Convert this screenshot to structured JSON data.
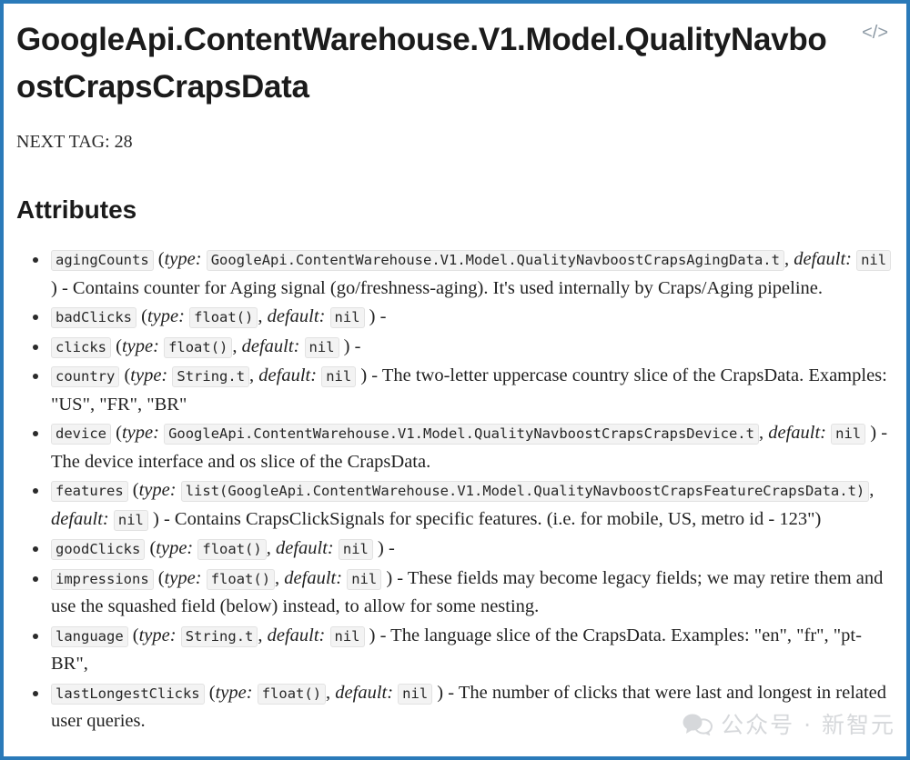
{
  "document": {
    "title": "GoogleApi.ContentWarehouse.V1.Model.QualityNavboostCrapsCrapsData",
    "code_icon": "</>",
    "next_tag": "NEXT TAG: 28",
    "section_heading": "Attributes"
  },
  "labels": {
    "type_label": "type:",
    "default_label": "default:",
    "open_paren": "(",
    "close_paren": ")",
    "comma": ",",
    "dash": "-"
  },
  "attributes": [
    {
      "name": "agingCounts",
      "type": "GoogleApi.ContentWarehouse.V1.Model.QualityNavboostCrapsAgingData.t",
      "default": "nil",
      "description": "Contains counter for Aging signal (go/freshness-aging). It's used internally by Craps/Aging pipeline."
    },
    {
      "name": "badClicks",
      "type": "float()",
      "default": "nil",
      "description": ""
    },
    {
      "name": "clicks",
      "type": "float()",
      "default": "nil",
      "description": ""
    },
    {
      "name": "country",
      "type": "String.t",
      "default": "nil",
      "description": "The two-letter uppercase country slice of the CrapsData. Examples: \"US\", \"FR\", \"BR\""
    },
    {
      "name": "device",
      "type": "GoogleApi.ContentWarehouse.V1.Model.QualityNavboostCrapsCrapsDevice.t",
      "default": "nil",
      "description": "The device interface and os slice of the CrapsData."
    },
    {
      "name": "features",
      "type": "list(GoogleApi.ContentWarehouse.V1.Model.QualityNavboostCrapsFeatureCrapsData.t)",
      "default": "nil",
      "description": "Contains CrapsClickSignals for specific features. (i.e. for mobile, US, metro id - 123\")"
    },
    {
      "name": "goodClicks",
      "type": "float()",
      "default": "nil",
      "description": ""
    },
    {
      "name": "impressions",
      "type": "float()",
      "default": "nil",
      "description": "These fields may become legacy fields; we may retire them and use the squashed field (below) instead, to allow for some nesting."
    },
    {
      "name": "language",
      "type": "String.t",
      "default": "nil",
      "description": "The language slice of the CrapsData. Examples: \"en\", \"fr\", \"pt-BR\","
    },
    {
      "name": "lastLongestClicks",
      "type": "float()",
      "default": "nil",
      "description": "The number of clicks that were last and longest in related user queries."
    }
  ],
  "watermark": {
    "text": "公众号 · 新智元",
    "icon": "wechat-icon"
  },
  "colors": {
    "frame_border": "#2a7ab9",
    "code_background": "#f3f3f3",
    "text": "#222222",
    "icon_muted": "#8d9aa5"
  }
}
